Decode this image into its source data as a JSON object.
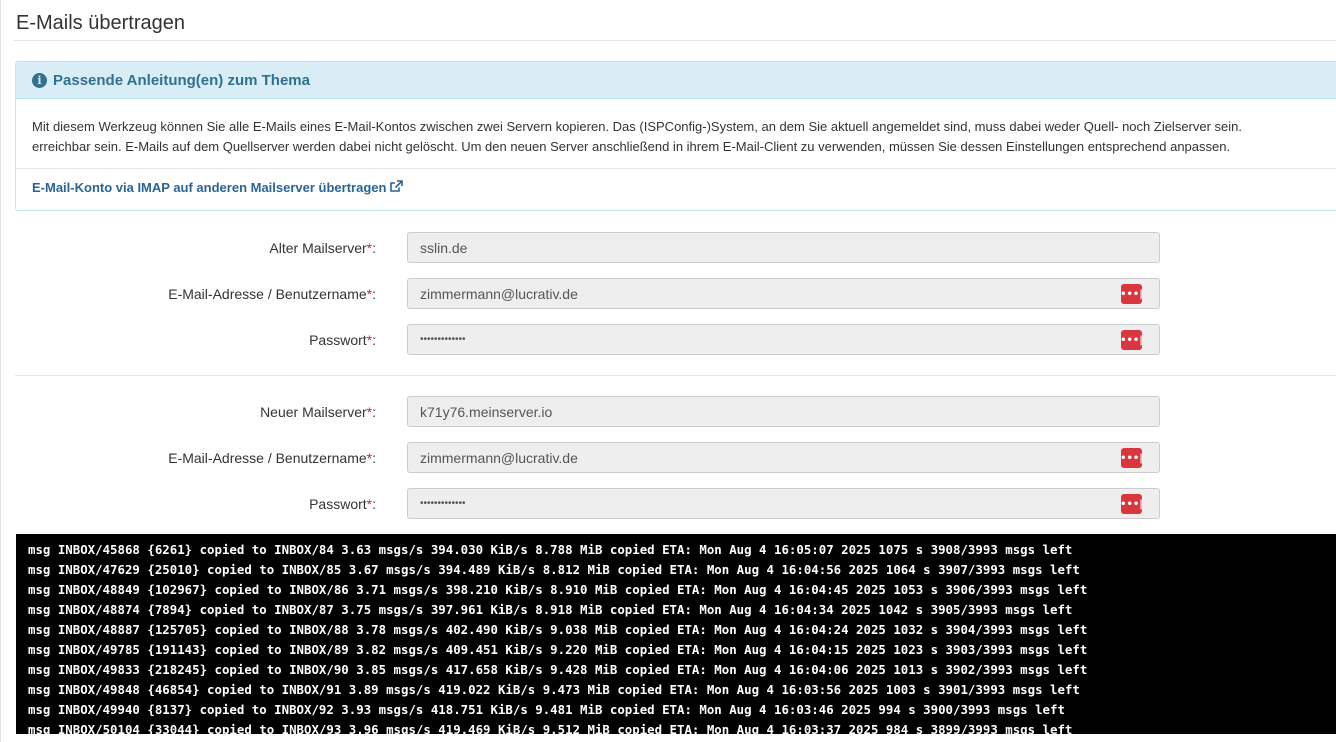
{
  "page": {
    "title": "E-Mails übertragen"
  },
  "info_panel": {
    "title": "Passende Anleitung(en) zum Thema",
    "body_line1": "Mit diesem Werkzeug können Sie alle E-Mails eines E-Mail-Kontos zwischen zwei Servern kopieren. Das (ISPConfig-)System, an dem Sie aktuell angemeldet sind, muss dabei weder Quell- noch Zielserver sein.",
    "body_line2": "erreichbar sein. E-Mails auf dem Quellserver werden dabei nicht gelöscht. Um den neuen Server anschließend in ihrem E-Mail-Client zu verwenden, müssen Sie dessen Einstellungen entsprechend anpassen.",
    "link_label": "E-Mail-Konto via IMAP auf anderen Mailserver übertragen",
    "link_icon": "external-link-icon"
  },
  "old_server": {
    "server_label": "Alter Mailserver",
    "server_value": "sslin.de",
    "user_label": "E-Mail-Adresse / Benutzername",
    "user_value": "zimmermann@lucrativ.de",
    "password_label": "Passwort",
    "password_value": "•••••••••••••"
  },
  "new_server": {
    "server_label": "Neuer Mailserver",
    "server_value": "k71y76.meinserver.io",
    "user_label": "E-Mail-Adresse / Benutzername",
    "user_value": "zimmermann@lucrativ.de",
    "password_label": "Passwort",
    "password_value": "•••••••••••••"
  },
  "required_mark": "*",
  "label_suffix": ":",
  "password_manager_icon_text": "•••|",
  "console": {
    "lines": [
      "msg INBOX/45868 {6261} copied to INBOX/84 3.63 msgs/s 394.030 KiB/s 8.788 MiB copied ETA: Mon Aug 4 16:05:07 2025 1075 s 3908/3993 msgs left",
      "msg INBOX/47629 {25010} copied to INBOX/85 3.67 msgs/s 394.489 KiB/s 8.812 MiB copied ETA: Mon Aug 4 16:04:56 2025 1064 s 3907/3993 msgs left",
      "msg INBOX/48849 {102967} copied to INBOX/86 3.71 msgs/s 398.210 KiB/s 8.910 MiB copied ETA: Mon Aug 4 16:04:45 2025 1053 s 3906/3993 msgs left",
      "msg INBOX/48874 {7894} copied to INBOX/87 3.75 msgs/s 397.961 KiB/s 8.918 MiB copied ETA: Mon Aug 4 16:04:34 2025 1042 s 3905/3993 msgs left",
      "msg INBOX/48887 {125705} copied to INBOX/88 3.78 msgs/s 402.490 KiB/s 9.038 MiB copied ETA: Mon Aug 4 16:04:24 2025 1032 s 3904/3993 msgs left",
      "msg INBOX/49785 {191143} copied to INBOX/89 3.82 msgs/s 409.451 KiB/s 9.220 MiB copied ETA: Mon Aug 4 16:04:15 2025 1023 s 3903/3993 msgs left",
      "msg INBOX/49833 {218245} copied to INBOX/90 3.85 msgs/s 417.658 KiB/s 9.428 MiB copied ETA: Mon Aug 4 16:04:06 2025 1013 s 3902/3993 msgs left",
      "msg INBOX/49848 {46854} copied to INBOX/91 3.89 msgs/s 419.022 KiB/s 9.473 MiB copied ETA: Mon Aug 4 16:03:56 2025 1003 s 3901/3993 msgs left",
      "msg INBOX/49940 {8137} copied to INBOX/92 3.93 msgs/s 418.751 KiB/s 9.481 MiB copied ETA: Mon Aug 4 16:03:46 2025 994 s 3900/3993 msgs left",
      "msg INBOX/50104 {33044} copied to INBOX/93 3.96 msgs/s 419.469 KiB/s 9.512 MiB copied ETA: Mon Aug 4 16:03:37 2025 984 s 3899/3993 msgs left"
    ]
  },
  "colors": {
    "info_bg": "#d9edf7",
    "info_text": "#31708f",
    "link": "#2a6496",
    "required": "#cc2222",
    "password_manager": "#d9363e",
    "console_bg": "#000000"
  }
}
